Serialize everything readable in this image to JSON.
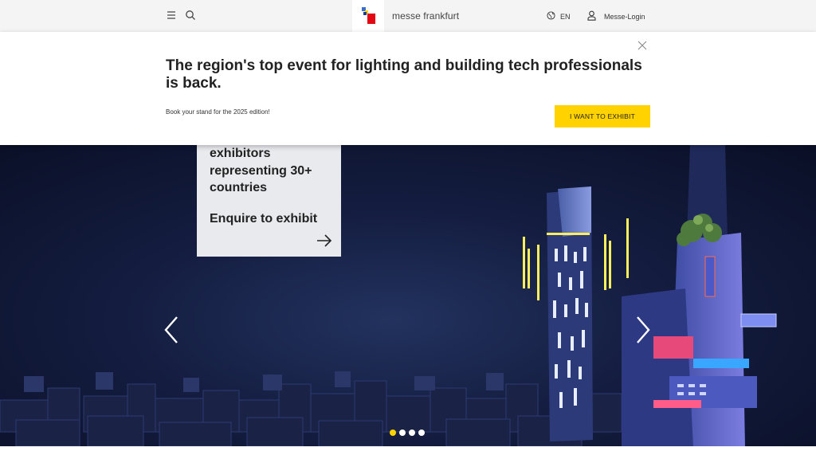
{
  "header": {
    "brand_name": "messe frankfurt",
    "language": "EN",
    "login_label": "Messe-Login",
    "icons": [
      "hamburger-menu-icon",
      "search-icon",
      "globe-icon",
      "user-icon"
    ],
    "logo_colors": [
      "#3a6fd0",
      "#ffd200",
      "#e30613"
    ]
  },
  "banner": {
    "headline": "The region's top event for lighting and building tech professionals is back.",
    "subtext": "Book your stand for the 2025 edition!",
    "cta_label": "I WANT TO EXHIBIT",
    "cta_color": "#ffd200"
  },
  "hero": {
    "card_text": "exhibitors representing 30+ countries",
    "card_cta": "Enquire to exhibit",
    "slides_total": 4,
    "active_slide": 1,
    "accent": "#ffd200"
  }
}
